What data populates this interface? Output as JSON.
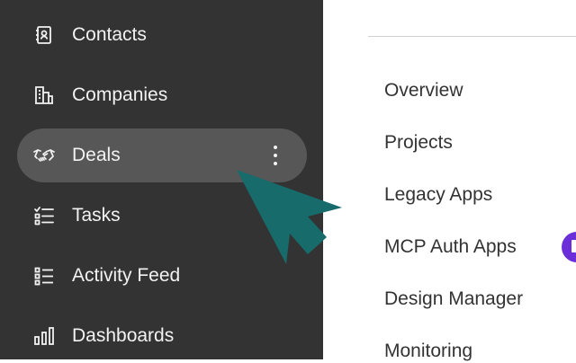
{
  "sidebar": {
    "items": [
      {
        "label": "Contacts",
        "icon": "contacts-icon"
      },
      {
        "label": "Companies",
        "icon": "companies-icon"
      },
      {
        "label": "Deals",
        "icon": "handshake-icon",
        "active": true
      },
      {
        "label": "Tasks",
        "icon": "tasks-icon"
      },
      {
        "label": "Activity Feed",
        "icon": "activity-feed-icon"
      },
      {
        "label": "Dashboards",
        "icon": "dashboards-icon"
      }
    ]
  },
  "submenu": {
    "items": [
      {
        "label": "Overview"
      },
      {
        "label": "Projects"
      },
      {
        "label": "Legacy Apps"
      },
      {
        "label": "MCP Auth Apps"
      },
      {
        "label": "Design Manager"
      },
      {
        "label": "Monitoring"
      }
    ]
  },
  "colors": {
    "sidebar_bg": "#333333",
    "active_item_bg": "#575757",
    "cursor_color": "#176b6b",
    "badge_color": "#6a2fd8"
  }
}
